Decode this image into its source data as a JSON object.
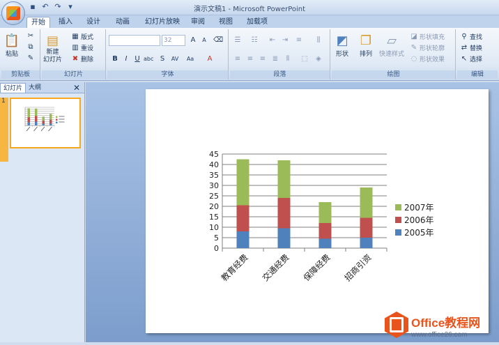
{
  "window": {
    "title": "演示文稿1 - Microsoft PowerPoint"
  },
  "qat": {
    "icons": [
      "save-icon",
      "undo-icon",
      "redo-icon",
      "customize-icon"
    ]
  },
  "tabs": [
    "开始",
    "插入",
    "设计",
    "动画",
    "幻灯片放映",
    "审阅",
    "视图",
    "加载项"
  ],
  "ribbon": {
    "clipboard": {
      "label": "剪贴板",
      "paste": "粘贴"
    },
    "slides": {
      "label": "幻灯片",
      "new_slide": "新建\n幻灯片",
      "layout": "版式",
      "reset": "重设",
      "delete": "删除"
    },
    "font": {
      "label": "字体",
      "font_name": "",
      "font_size": "32"
    },
    "paragraph": {
      "label": "段落"
    },
    "drawing": {
      "label": "绘图",
      "shapes": "形状",
      "arrange": "排列",
      "quick_styles": "快速样式",
      "shape_fill": "形状填充",
      "shape_outline": "形状轮廓",
      "shape_effects": "形状效果"
    },
    "editing": {
      "label": "编辑",
      "find": "查找",
      "replace": "替换",
      "select": "选择"
    }
  },
  "pane": {
    "tabs": [
      "幻灯片",
      "大纲"
    ],
    "slide_number": "1"
  },
  "chart_data": {
    "type": "bar",
    "stacked": true,
    "categories": [
      "教育经费",
      "交通经费",
      "保障经费",
      "招商引资"
    ],
    "series": [
      {
        "name": "2005年",
        "color": "#4f81bd",
        "values": [
          8,
          9.5,
          4.5,
          5
        ]
      },
      {
        "name": "2006年",
        "color": "#c0504d",
        "values": [
          12.5,
          14.5,
          7.5,
          9.5
        ]
      },
      {
        "name": "2007年",
        "color": "#9bbb59",
        "values": [
          22,
          18,
          10,
          14.5
        ]
      }
    ],
    "ylim": [
      0,
      45
    ],
    "yticks": [
      0,
      5,
      10,
      15,
      20,
      25,
      30,
      35,
      40,
      45
    ],
    "grid": true,
    "legend": "right",
    "title": "",
    "xlabel": "",
    "ylabel": ""
  },
  "watermark": {
    "title": "Office教程网",
    "url": "www.office26.com"
  }
}
